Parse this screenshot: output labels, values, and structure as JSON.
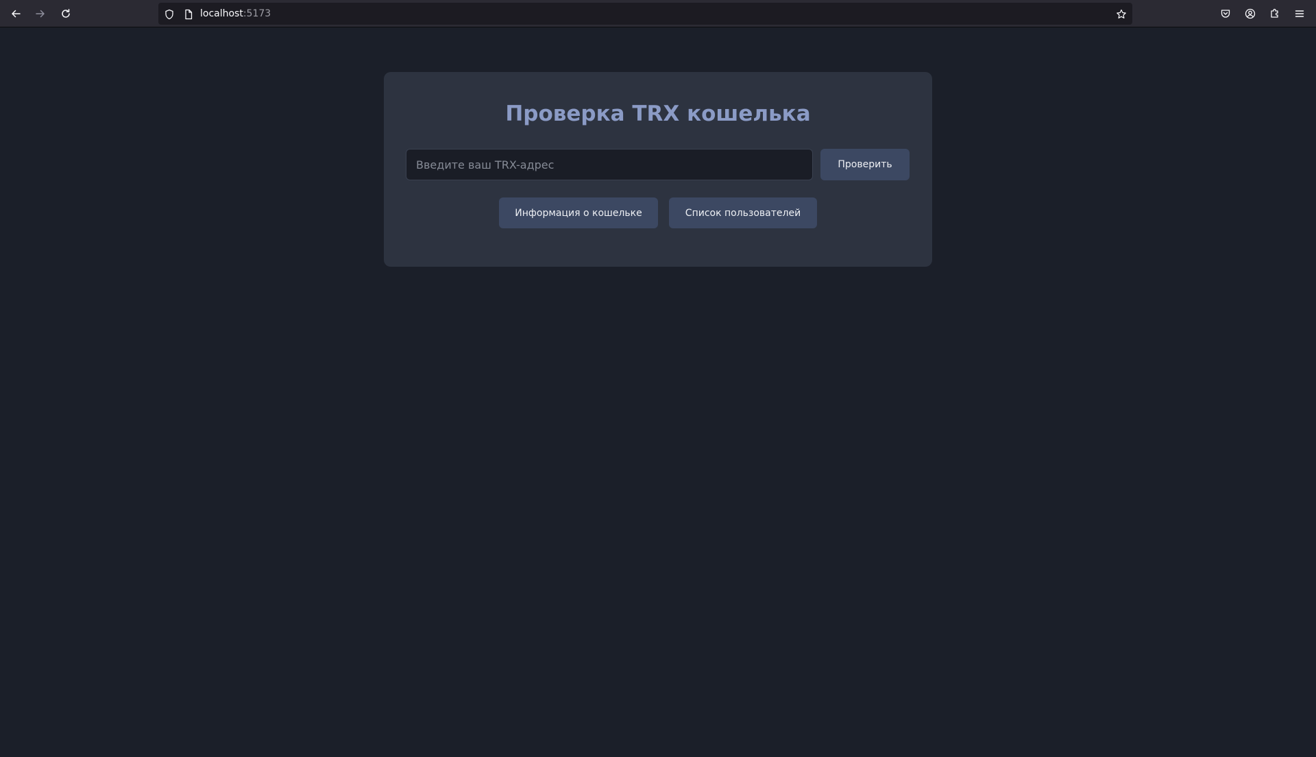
{
  "browser": {
    "url_host": "localhost",
    "url_port": ":5173",
    "icons": {
      "back": "arrow-left-icon",
      "forward": "arrow-right-icon",
      "reload": "reload-icon",
      "tracking": "shield-icon",
      "page": "page-icon",
      "bookmark": "star-icon",
      "pocket": "pocket-icon",
      "account": "account-icon",
      "extensions": "puzzle-icon",
      "menu": "hamburger-icon"
    }
  },
  "page": {
    "title": "Проверка TRX кошелька",
    "address_input": {
      "value": "",
      "placeholder": "Введите ваш TRX-адрес"
    },
    "check_button": "Проверить",
    "wallet_info_button": "Информация о кошельке",
    "users_list_button": "Список пользователей"
  },
  "colors": {
    "background": "#1b1f29",
    "card": "#2d3340",
    "title": "#8b9bc6",
    "button": "#3c4862"
  }
}
